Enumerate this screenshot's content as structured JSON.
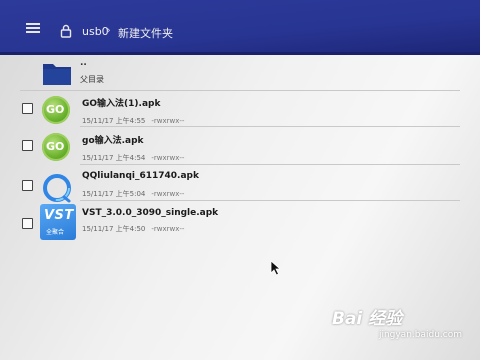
{
  "header": {
    "crumb_root": "usb0",
    "crumb_separator": "›",
    "crumb_folder": "新建文件夹"
  },
  "parent": {
    "dots": "..",
    "label": "父目录"
  },
  "files": [
    {
      "name": "GO输入法(1).apk",
      "date": "15/11/17 上午4:55",
      "perm": "-rwxrwx--"
    },
    {
      "name": "go输入法.apk",
      "date": "15/11/17 上午4:54",
      "perm": "-rwxrwx--"
    },
    {
      "name": "QQliulanqi_611740.apk",
      "date": "15/11/17 上午5:04",
      "perm": "-rwxrwx--"
    },
    {
      "name": "VST_3.0.0_3090_single.apk",
      "date": "15/11/17 上午4:50",
      "perm": "-rwxrwx--"
    }
  ],
  "icons": {
    "go_letters": "GO",
    "vst_big": "VST",
    "vst_small": "全聚合",
    "names": [
      "menu-icon",
      "lock-icon",
      "folder-icon",
      "go-app-icon",
      "qq-browser-icon",
      "vst-app-icon",
      "mouse-cursor-icon"
    ]
  },
  "watermark": {
    "logo": "Bai 经验",
    "site": "jingyan.baidu.com"
  },
  "colors": {
    "topbar": "#283592",
    "folder": "#1f3a8a",
    "go_green": "#6cb32f",
    "vst_blue": "#2a7bd8"
  }
}
